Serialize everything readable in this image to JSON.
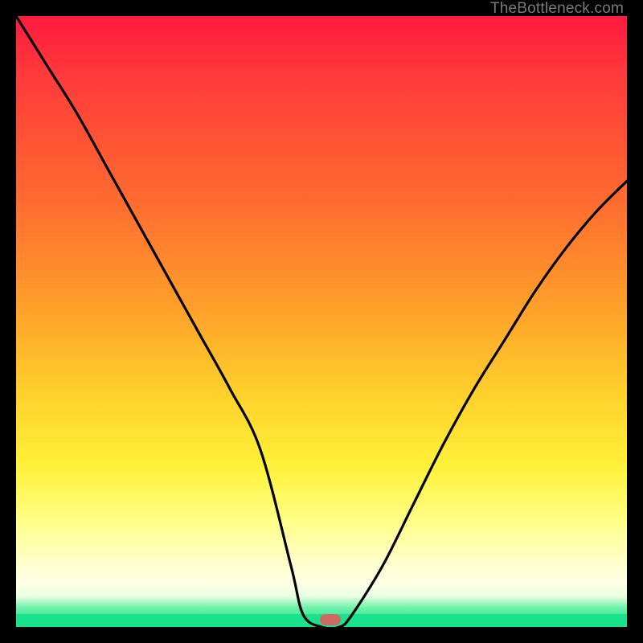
{
  "watermark": "TheBottleneck.com",
  "colors": {
    "frame_bg": "#000000",
    "curve_stroke": "#000000",
    "marker_fill": "#cf6a63",
    "green_strip": "#18e28c"
  },
  "chart_data": {
    "type": "line",
    "title": "",
    "xlabel": "",
    "ylabel": "",
    "xlim": [
      0,
      100
    ],
    "ylim": [
      0,
      100
    ],
    "grid": false,
    "legend": false,
    "series": [
      {
        "name": "bottleneck-curve",
        "x": [
          0,
          5,
          10,
          15,
          20,
          25,
          30,
          35,
          40,
          45,
          47,
          50,
          53,
          55,
          60,
          65,
          70,
          75,
          80,
          85,
          90,
          95,
          100
        ],
        "values": [
          100,
          92,
          84,
          75,
          66,
          57,
          48,
          39,
          29,
          10,
          2,
          0,
          0,
          2,
          10,
          20,
          30,
          39,
          47,
          55,
          62,
          68,
          73
        ]
      }
    ],
    "annotations": [
      {
        "name": "optimum-marker",
        "x": 51.5,
        "y": 1.2,
        "color": "#cf6a63"
      }
    ]
  }
}
